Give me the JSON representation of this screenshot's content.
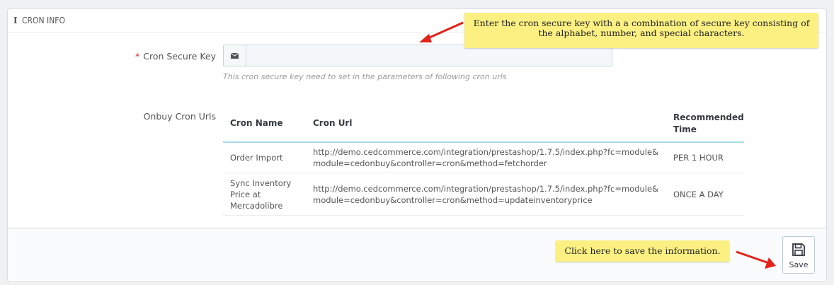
{
  "panel": {
    "title": "CRON INFO",
    "icon": "info-icon"
  },
  "form": {
    "secure_key": {
      "required_mark": "*",
      "label": "Cron Secure Key",
      "value": "",
      "icon": "envelope-icon",
      "help": "This cron secure key need to set in the parameters of following cron urls"
    },
    "cron_urls": {
      "label": "Onbuy Cron Urls",
      "table": {
        "columns": [
          "Cron Name",
          "Cron Url",
          "Recommended Time"
        ],
        "rows": [
          {
            "name": "Order Import",
            "url": "http://demo.cedcommerce.com/integration/prestashop/1.7.5/index.php?fc=module&module=cedonbuy&controller=cron&method=fetchorder",
            "time": "PER 1 HOUR"
          },
          {
            "name": "Sync Inventory Price at Mercadolibre",
            "url": "http://demo.cedcommerce.com/integration/prestashop/1.7.5/index.php?fc=module&module=cedonbuy&controller=cron&method=updateinventoryprice",
            "time": "ONCE A DAY"
          }
        ]
      }
    }
  },
  "footer": {
    "save_label": "Save",
    "save_icon": "floppy-disk-icon"
  },
  "annotations": {
    "top": "Enter the cron secure key with a a combination of secure key consisting of the alphabet, number, and special characters.",
    "bottom": "Click here to save the information.",
    "highlight_color": "#fcf082",
    "arrow_color": "#e2231a"
  }
}
